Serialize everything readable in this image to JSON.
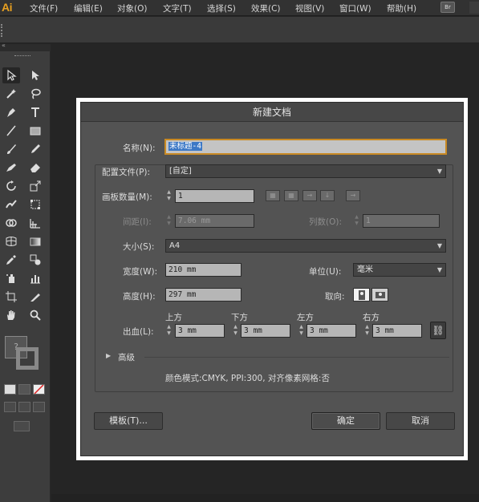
{
  "app": {
    "logo": "Ai",
    "menu": [
      "文件(F)",
      "编辑(E)",
      "对象(O)",
      "文字(T)",
      "选择(S)",
      "效果(C)",
      "视图(V)",
      "窗口(W)",
      "帮助(H)"
    ],
    "bridge_button": "Br"
  },
  "toolbox": {
    "collapse_glyph": "«",
    "tools": [
      "selection-tool",
      "direct-selection-tool",
      "magic-wand-tool",
      "lasso-tool",
      "pen-tool",
      "type-tool",
      "line-segment-tool",
      "rectangle-tool",
      "paintbrush-tool",
      "pencil-tool",
      "blob-brush-tool",
      "eraser-tool",
      "rotate-tool",
      "scale-tool",
      "warp-tool",
      "free-transform-tool",
      "shape-builder-tool",
      "perspective-grid-tool",
      "mesh-tool",
      "gradient-tool",
      "eyedropper-tool",
      "blend-tool",
      "symbol-sprayer-tool",
      "column-graph-tool",
      "artboard-tool",
      "slice-tool",
      "hand-tool",
      "zoom-tool"
    ],
    "fill_stroke_question": "?"
  },
  "dialog": {
    "title": "新建文档",
    "name_label": "名称(N):",
    "name_value": "未标题-4",
    "profile_label": "配置文件(P):",
    "profile_value": "[自定]",
    "artboards_label": "画板数量(M):",
    "artboards_value": "1",
    "spacing_label": "间距(I):",
    "spacing_value": "7.06 mm",
    "columns_label": "列数(O):",
    "columns_value": "1",
    "size_label": "大小(S):",
    "size_value": "A4",
    "width_label": "宽度(W):",
    "width_value": "210 mm",
    "units_label": "单位(U):",
    "units_value": "毫米",
    "height_label": "高度(H):",
    "height_value": "297 mm",
    "orientation_label": "取向:",
    "bleed_label": "出血(L):",
    "bleed": {
      "top_label": "上方",
      "top_value": "3 mm",
      "bottom_label": "下方",
      "bottom_value": "3 mm",
      "left_label": "左方",
      "left_value": "3 mm",
      "right_label": "右方",
      "right_value": "3 mm"
    },
    "advanced_label": "高级",
    "color_mode_info": "颜色模式:CMYK, PPI:300, 对齐像素网格:否",
    "templates_button": "模板(T)...",
    "ok_button": "确定",
    "cancel_button": "取消"
  }
}
